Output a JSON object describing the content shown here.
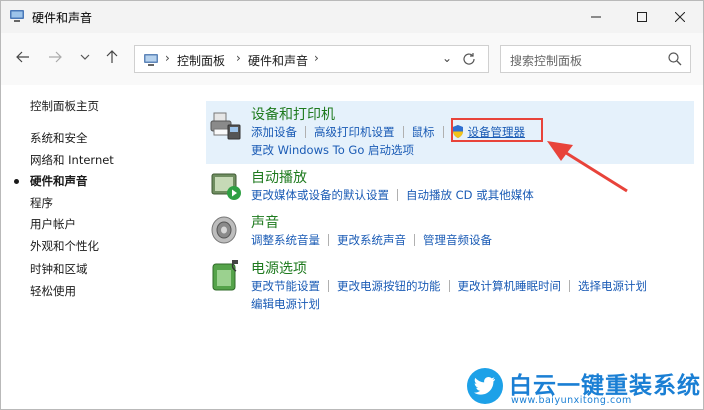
{
  "window": {
    "title": "硬件和声音"
  },
  "nav": {
    "breadcrumb": [
      "控制面板",
      "硬件和声音"
    ],
    "search_placeholder": "搜索控制面板"
  },
  "sidebar": {
    "items": [
      {
        "label": "控制面板主页"
      },
      {
        "label": "系统和安全"
      },
      {
        "label": "网络和 Internet"
      },
      {
        "label": "硬件和声音",
        "current": true
      },
      {
        "label": "程序"
      },
      {
        "label": "用户帐户"
      },
      {
        "label": "外观和个性化"
      },
      {
        "label": "时钟和区域"
      },
      {
        "label": "轻松使用"
      }
    ]
  },
  "categories": [
    {
      "title": "设备和打印机",
      "icon": "printer-icon",
      "links_row1": [
        "添加设备",
        "高级打印机设置",
        "鼠标",
        "设备管理器"
      ],
      "links_row2": [
        "更改 Windows To Go 启动选项"
      ]
    },
    {
      "title": "自动播放",
      "icon": "autoplay-icon",
      "links_row1": [
        "更改媒体或设备的默认设置",
        "自动播放 CD 或其他媒体"
      ]
    },
    {
      "title": "声音",
      "icon": "speaker-icon",
      "links_row1": [
        "调整系统音量",
        "更改系统声音",
        "管理音频设备"
      ]
    },
    {
      "title": "电源选项",
      "icon": "power-icon",
      "links_row1": [
        "更改节能设置",
        "更改电源按钮的功能",
        "更改计算机睡眠时间",
        "选择电源计划"
      ],
      "links_row2": [
        "编辑电源计划"
      ]
    }
  ],
  "watermark": {
    "title": "白云一键重装系统",
    "url": "www.baiyunxitong.com"
  },
  "colors": {
    "category_title": "#1e7a1e",
    "link": "#1a5bb5",
    "highlight_bg": "#e5f1fb",
    "annotation": "#e8433a",
    "watermark": "#1a7fd4"
  }
}
